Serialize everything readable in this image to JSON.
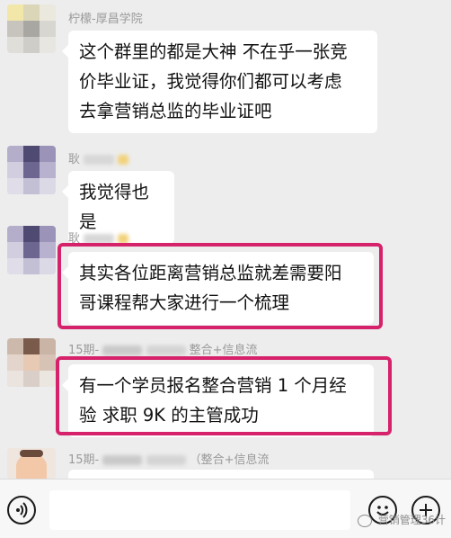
{
  "messages": [
    {
      "sender": "柠檬-厚昌学院",
      "lines": [
        "这个群里的都是大神 不在乎一张竞",
        "价毕业证，我觉得你们都可以考虑",
        "去拿营销总监的毕业证吧"
      ]
    },
    {
      "sender": "耿",
      "lines": [
        "我觉得也是"
      ]
    },
    {
      "sender": "耿",
      "lines": [
        "其实各位距离营销总监就差需要阳",
        "哥课程帮大家进行一个梳理"
      ]
    },
    {
      "sender_prefix": "15期-",
      "sender_suffix": "整合+信息流",
      "lines": [
        "有一个学员报名整合营销 1 个月经",
        "验 求职 9K 的主管成功"
      ]
    },
    {
      "sender_prefix": "15期-",
      "sender_suffix": "（整合+信息流"
    }
  ],
  "watermark": "营销管理36计",
  "colors": {
    "highlight": "#d6226b",
    "background": "#ededed"
  },
  "icons": {
    "voice": "voice-icon",
    "emoji": "emoji-icon",
    "plus": "plus-icon",
    "wechat": "wechat-logo-icon"
  }
}
